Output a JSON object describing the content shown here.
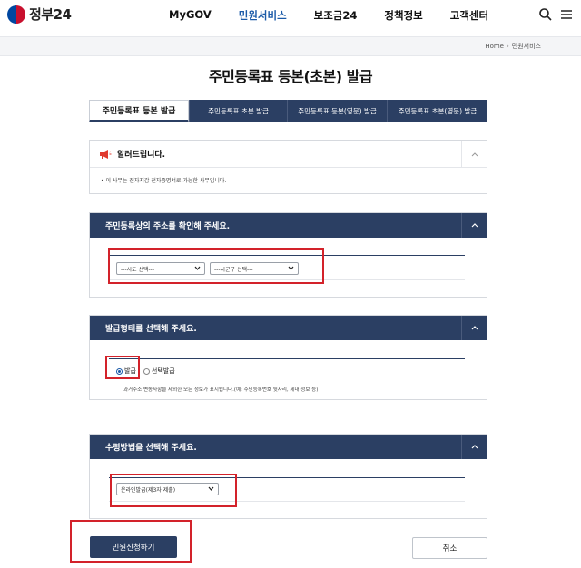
{
  "header": {
    "logo_text": "정부24",
    "nav": [
      "MyGOV",
      "민원서비스",
      "보조금24",
      "정책정보",
      "고객센터"
    ],
    "active_nav_index": 1,
    "search_icon": "search-icon",
    "menu_icon": "hamburger-menu-icon"
  },
  "breadcrumb": {
    "home": "Home",
    "current": "민원서비스"
  },
  "page_title": "주민등록표 등본(초본) 발급",
  "tabs": [
    "주민등록표 등본 발급",
    "주민등록표 초본 발급",
    "주민등록표 등본(영문) 발급",
    "주민등록표 초본(영문) 발급"
  ],
  "notice": {
    "icon": "megaphone-icon",
    "title": "알려드립니다.",
    "body": "이 사무는 전자지갑 전자증명서로 가능한 사무입니다."
  },
  "address": {
    "title": "주민등록상의 주소를 확인해 주세요.",
    "sido": "---시도 선택---",
    "sigungu": "---시군구 선택---"
  },
  "issue_type": {
    "title": "발급형태를 선택해 주세요.",
    "options": [
      "발급",
      "선택발급"
    ],
    "selected": "발급",
    "note": "과거주소 변동사항을 제외한 모든 정보가 표시됩니다.(예: 주민등록번호 뒷자리, 세대 정보 등)"
  },
  "receive": {
    "title": "수령방법을 선택해 주세요.",
    "method": "온라인발급(제3자 제출)"
  },
  "buttons": {
    "submit": "민원신청하기",
    "cancel": "취소"
  },
  "colors": {
    "navy": "#2b3f63",
    "active_nav": "#1a5aa8",
    "highlight": "#d3222a"
  }
}
